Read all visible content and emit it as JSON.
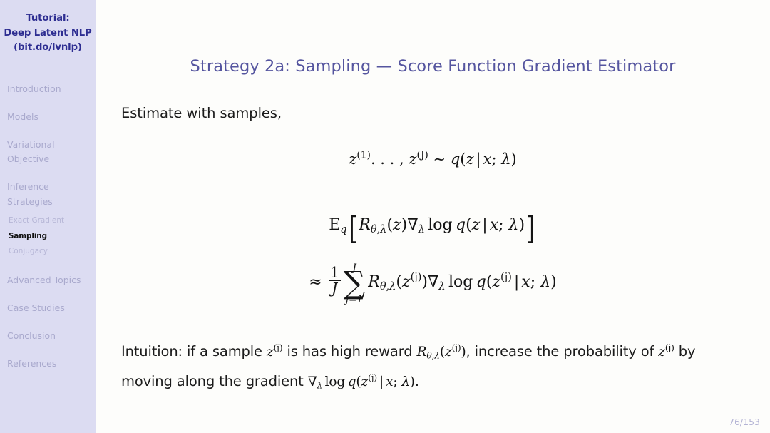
{
  "sidebar": {
    "title_lines": [
      "Tutorial:",
      "Deep Latent NLP",
      "(bit.do/lvnlp)"
    ],
    "background_color": "#dcdcf2",
    "title_color": "#2d2d91",
    "item_color": "#a9a9cd",
    "active_color": "#121212",
    "sections": [
      {
        "label": "Introduction",
        "active": false,
        "level": 1
      },
      {
        "label": "Models",
        "active": false,
        "level": 1
      },
      {
        "label": "Variational Objective",
        "active": false,
        "level": 1
      },
      {
        "label": "Inference Strategies",
        "active": false,
        "level": 1
      },
      {
        "label": "Exact Gradient",
        "active": false,
        "level": 2
      },
      {
        "label": "Sampling",
        "active": true,
        "level": 2
      },
      {
        "label": "Conjugacy",
        "active": false,
        "level": 2
      },
      {
        "label": "Advanced Topics",
        "active": false,
        "level": 1
      },
      {
        "label": "Case Studies",
        "active": false,
        "level": 1
      },
      {
        "label": "Conclusion",
        "active": false,
        "level": 1
      },
      {
        "label": "References",
        "active": false,
        "level": 1
      }
    ]
  },
  "slide": {
    "title": "Strategy 2a: Sampling — Score Function Gradient Estimator",
    "title_color": "#55559f",
    "background_color": "#fdfdfb",
    "intro_text": "Estimate with samples,",
    "equations": {
      "sampling": "z^(1), …, z^(J) ~ q(z | x; λ)",
      "expectation": "E_q [ R_{θ,λ}(z) ∇_λ log q(z | x; λ) ]",
      "estimator": "≈ (1/J) Σ_{j=1}^{J} R_{θ,λ}(z^(j)) ∇_λ log q(z^(j) | x; λ)",
      "symbols": {
        "z": "z",
        "q": "q",
        "x": "x",
        "lambda": "λ",
        "theta": "θ",
        "J": "J",
        "j": "j",
        "R": "R",
        "E": "E",
        "nabla": "∇",
        "log": "log",
        "sim": "∼",
        "approx": "≈",
        "sum": "∑",
        "one": "1",
        "jeq1": "j=1",
        "sup_1": "(1)",
        "sup_J": "(J)",
        "sup_j": "(j)",
        "ellipsis": ". . . ,",
        "mid": "|",
        "semicolon": ";"
      }
    },
    "intuition": {
      "lead": "Intuition:",
      "part1": " if a sample ",
      "part2": " is has high reward ",
      "part3": ", increase the probability of ",
      "part4": " by moving along the gradient ",
      "part5": "."
    },
    "page_number": "76/153",
    "page_number_color": "#b3b3d4"
  }
}
